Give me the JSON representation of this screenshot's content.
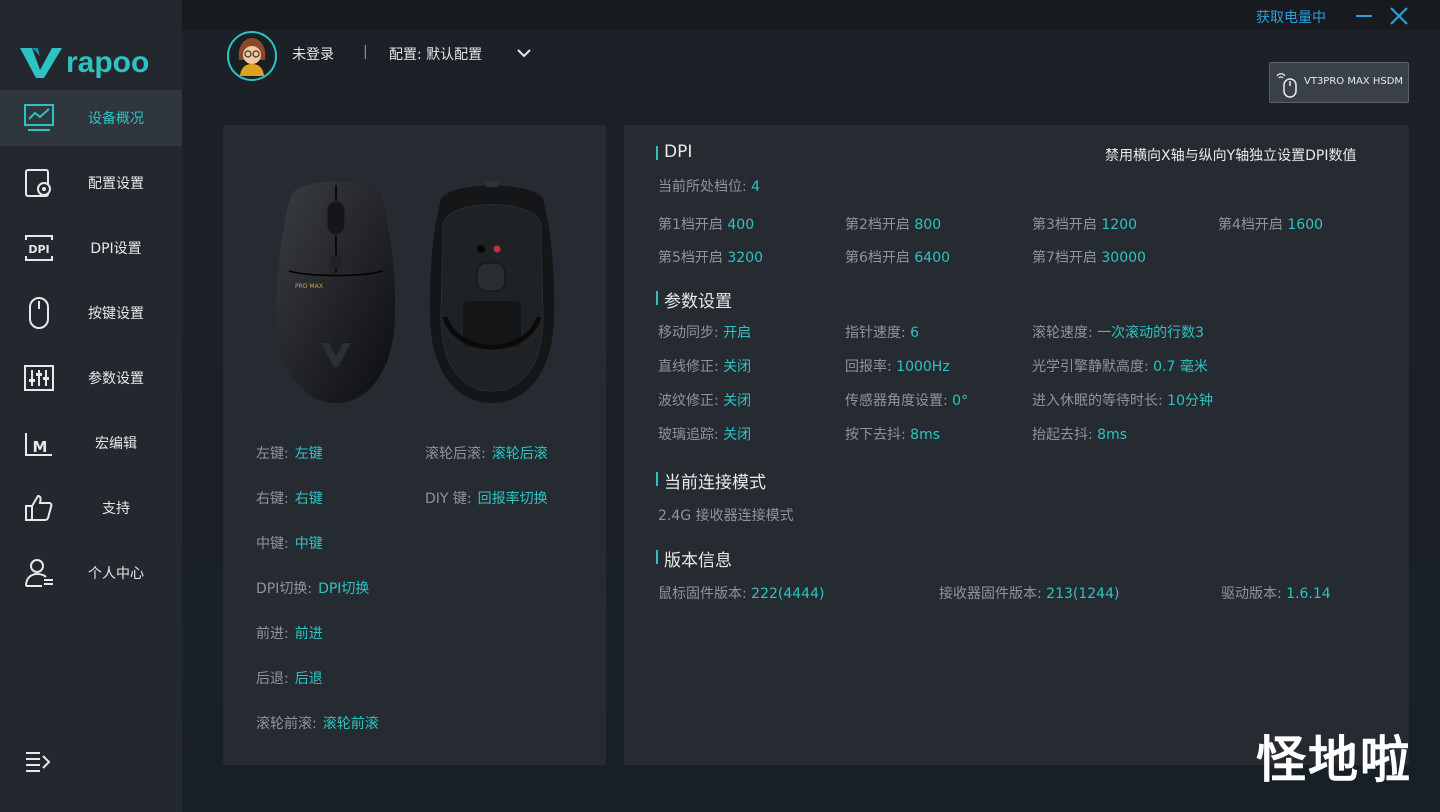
{
  "app": {
    "brand": "rapoo"
  },
  "sidebar": {
    "items": [
      {
        "label": "设备概况",
        "icon": "monitor-chart-icon",
        "active": true
      },
      {
        "label": "配置设置",
        "icon": "config-gear-icon"
      },
      {
        "label": "DPI设置",
        "icon": "dpi-icon"
      },
      {
        "label": "按键设置",
        "icon": "mouse-icon"
      },
      {
        "label": "参数设置",
        "icon": "sliders-icon"
      },
      {
        "label": "宏编辑",
        "icon": "macro-icon"
      },
      {
        "label": "支持",
        "icon": "thumbs-up-icon"
      },
      {
        "label": "个人中心",
        "icon": "user-icon"
      }
    ]
  },
  "titlebar": {
    "battery_link": "获取电量中"
  },
  "user": {
    "name": "未登录",
    "divider": "|",
    "config": "配置: 默认配置"
  },
  "device": {
    "name": "VT3PRO MAX HSDM"
  },
  "buttons": {
    "left": [
      {
        "key": "左键:",
        "value": "左键"
      },
      {
        "key": "右键:",
        "value": "右键"
      },
      {
        "key": "中键:",
        "value": "中键"
      },
      {
        "key": "DPI切换:",
        "value": "DPI切换"
      },
      {
        "key": "前进:",
        "value": "前进"
      },
      {
        "key": "后退:",
        "value": "后退"
      },
      {
        "key": "滚轮前滚:",
        "value": "滚轮前滚"
      }
    ],
    "right": [
      {
        "key": "滚轮后滚:",
        "value": "滚轮后滚"
      },
      {
        "key": "DIY 键:",
        "value": "回报率切换"
      }
    ]
  },
  "dpi": {
    "title": "DPI",
    "note": "禁用横向X轴与纵向Y轴独立设置DPI数值",
    "current_label": "当前所处档位:",
    "current_value": "4",
    "levels": [
      {
        "key": "第1档开启",
        "value": "400"
      },
      {
        "key": "第2档开启",
        "value": "800"
      },
      {
        "key": "第3档开启",
        "value": "1200"
      },
      {
        "key": "第4档开启",
        "value": "1600"
      },
      {
        "key": "第5档开启",
        "value": "3200"
      },
      {
        "key": "第6档开启",
        "value": "6400"
      },
      {
        "key": "第7档开启",
        "value": "30000"
      }
    ]
  },
  "params": {
    "title": "参数设置",
    "items": [
      {
        "key": "移动同步:",
        "value": "开启"
      },
      {
        "key": "指针速度:",
        "value": "6"
      },
      {
        "key": "滚轮速度:",
        "value": "一次滚动的行数3"
      },
      {
        "key": "直线修正:",
        "value": "关闭"
      },
      {
        "key": "回报率:",
        "value": "1000Hz"
      },
      {
        "key": "光学引擎静默高度:",
        "value": "0.7 毫米"
      },
      {
        "key": "波纹修正:",
        "value": "关闭"
      },
      {
        "key": "传感器角度设置:",
        "value": "0°"
      },
      {
        "key": "进入休眠的等待时长:",
        "value": "10分钟"
      },
      {
        "key": "玻璃追踪:",
        "value": "关闭"
      },
      {
        "key": "按下去抖:",
        "value": "8ms"
      },
      {
        "key": "抬起去抖:",
        "value": "8ms"
      }
    ]
  },
  "connection": {
    "title": "当前连接模式",
    "value": "2.4G 接收器连接模式"
  },
  "version": {
    "title": "版本信息",
    "items": [
      {
        "key": "鼠标固件版本:",
        "value": "222(4444)"
      },
      {
        "key": "接收器固件版本:",
        "value": "213(1244)"
      },
      {
        "key": "驱动版本:",
        "value": "1.6.14"
      }
    ]
  },
  "watermark": "怪地啦",
  "colors": {
    "accent": "#2ec3c3",
    "link": "#2a9fd8",
    "panel": "#262b31",
    "sidebar": "#23282e"
  }
}
